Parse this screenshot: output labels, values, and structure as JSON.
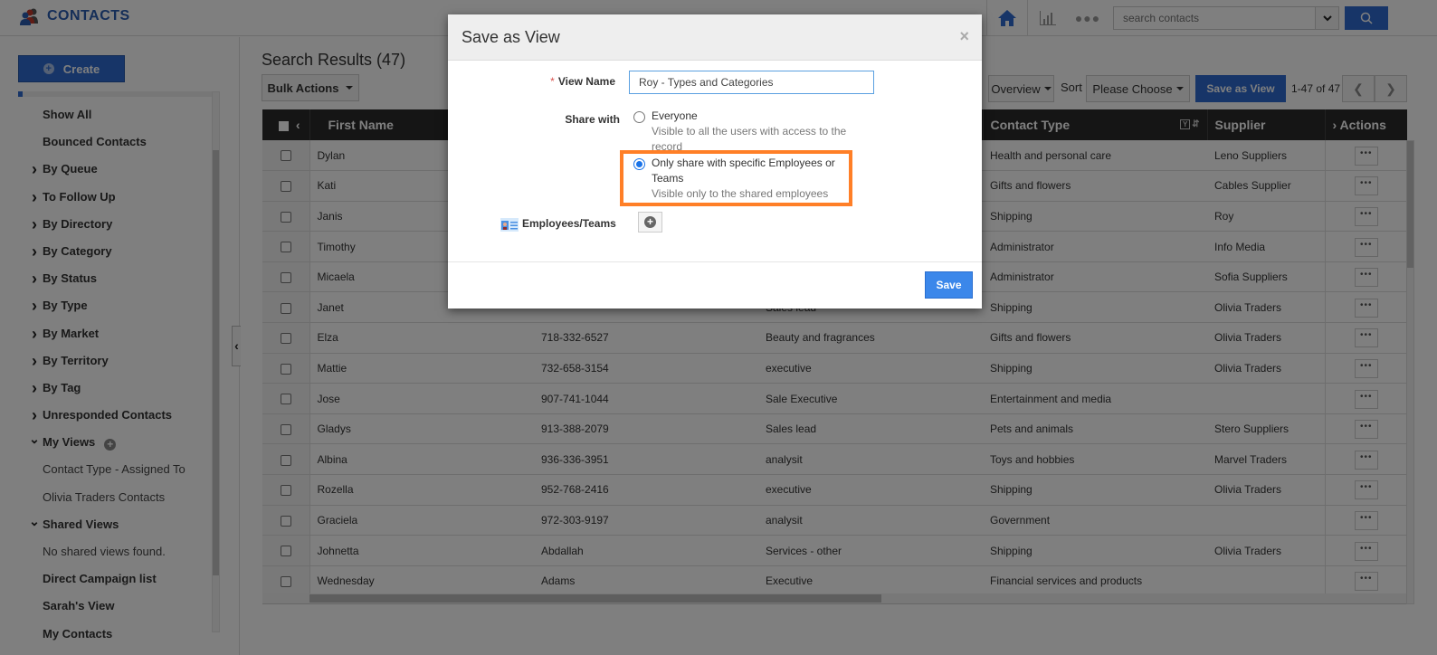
{
  "app": {
    "title": "CONTACTS",
    "search_placeholder": "search contacts"
  },
  "sidebar": {
    "create_label": "Create",
    "items": [
      {
        "label": "Show All",
        "type": "link"
      },
      {
        "label": "Bounced Contacts",
        "type": "link"
      },
      {
        "label": "By Queue",
        "type": "group",
        "expanded": false
      },
      {
        "label": "To Follow Up",
        "type": "group",
        "expanded": false
      },
      {
        "label": "By Directory",
        "type": "group",
        "expanded": false
      },
      {
        "label": "By Category",
        "type": "group",
        "expanded": false
      },
      {
        "label": "By Status",
        "type": "group",
        "expanded": false
      },
      {
        "label": "By Type",
        "type": "group",
        "expanded": false
      },
      {
        "label": "By Market",
        "type": "group",
        "expanded": false
      },
      {
        "label": "By Territory",
        "type": "group",
        "expanded": false
      },
      {
        "label": "By Tag",
        "type": "group",
        "expanded": false
      },
      {
        "label": "Unresponded Contacts",
        "type": "group",
        "expanded": false
      },
      {
        "label": "My Views",
        "type": "group",
        "expanded": true
      },
      {
        "label": "Contact Type - Assigned To",
        "type": "sub"
      },
      {
        "label": "Olivia Traders Contacts",
        "type": "sub"
      },
      {
        "label": "Shared Views",
        "type": "group",
        "expanded": true
      },
      {
        "label": "No shared views found.",
        "type": "sub"
      },
      {
        "label": "Direct Campaign list",
        "type": "link"
      },
      {
        "label": "Sarah's View",
        "type": "link"
      },
      {
        "label": "My Contacts",
        "type": "link"
      }
    ]
  },
  "main": {
    "title": "Search Results (47)",
    "bulk_actions_label": "Bulk Actions",
    "overview_label": "Overview",
    "sort_label": "Sort",
    "sort_value": "Please Choose",
    "save_as_view_label": "Save as View",
    "page_count": "1-47 of 47",
    "columns": [
      "First Name",
      "",
      "",
      "Contact Type",
      "Supplier",
      "Actions"
    ],
    "rows": [
      [
        "Dylan",
        "",
        "",
        "Health and personal care",
        "Leno Suppliers"
      ],
      [
        "Kati",
        "",
        "",
        "Gifts and flowers",
        "Cables Supplier"
      ],
      [
        "Janis",
        "",
        "",
        "Shipping",
        "Roy"
      ],
      [
        "Timothy",
        "",
        "",
        "Administrator",
        "Info Media"
      ],
      [
        "Micaela",
        "",
        "",
        "Administrator",
        "Sofia Suppliers"
      ],
      [
        "Janet",
        "",
        "Sales lead",
        "Shipping",
        "Olivia Traders"
      ],
      [
        "Elza",
        "718-332-6527",
        "Beauty and fragrances",
        "Gifts and flowers",
        "Olivia Traders"
      ],
      [
        "Mattie",
        "732-658-3154",
        "executive",
        "Shipping",
        "Olivia Traders"
      ],
      [
        "Jose",
        "907-741-1044",
        "Sale Executive",
        "Entertainment and media",
        ""
      ],
      [
        "Gladys",
        "913-388-2079",
        "Sales lead",
        "Pets and animals",
        "Stero Suppliers"
      ],
      [
        "Albina",
        "936-336-3951",
        "analysit",
        "Toys and hobbies",
        "Marvel Traders"
      ],
      [
        "Rozella",
        "952-768-2416",
        "executive",
        "Shipping",
        "Olivia Traders"
      ],
      [
        "Graciela",
        "972-303-9197",
        "analysit",
        "Government",
        ""
      ],
      [
        "Johnetta",
        "Abdallah",
        "Services - other",
        "Shipping",
        "Olivia Traders"
      ],
      [
        "Wednesday",
        "Adams",
        "Executive",
        "Financial services and products",
        ""
      ]
    ],
    "row_action_label": "•••"
  },
  "modal": {
    "title": "Save as View",
    "close_label": "×",
    "view_name_label": "View Name",
    "view_name_value": "Roy - Types and Categories",
    "share_with_label": "Share with",
    "options": [
      {
        "title": "Everyone",
        "desc": "Visible to all the users with access to the record",
        "selected": false
      },
      {
        "title": "Only share with specific Employees or Teams",
        "desc": "Visible only to the shared employees",
        "selected": true
      }
    ],
    "employees_label": "Employees/Teams",
    "save_label": "Save"
  },
  "colors": {
    "accent": "#2f6bd0",
    "highlight": "#ff7f27",
    "header_dark": "#2b2b2b"
  }
}
